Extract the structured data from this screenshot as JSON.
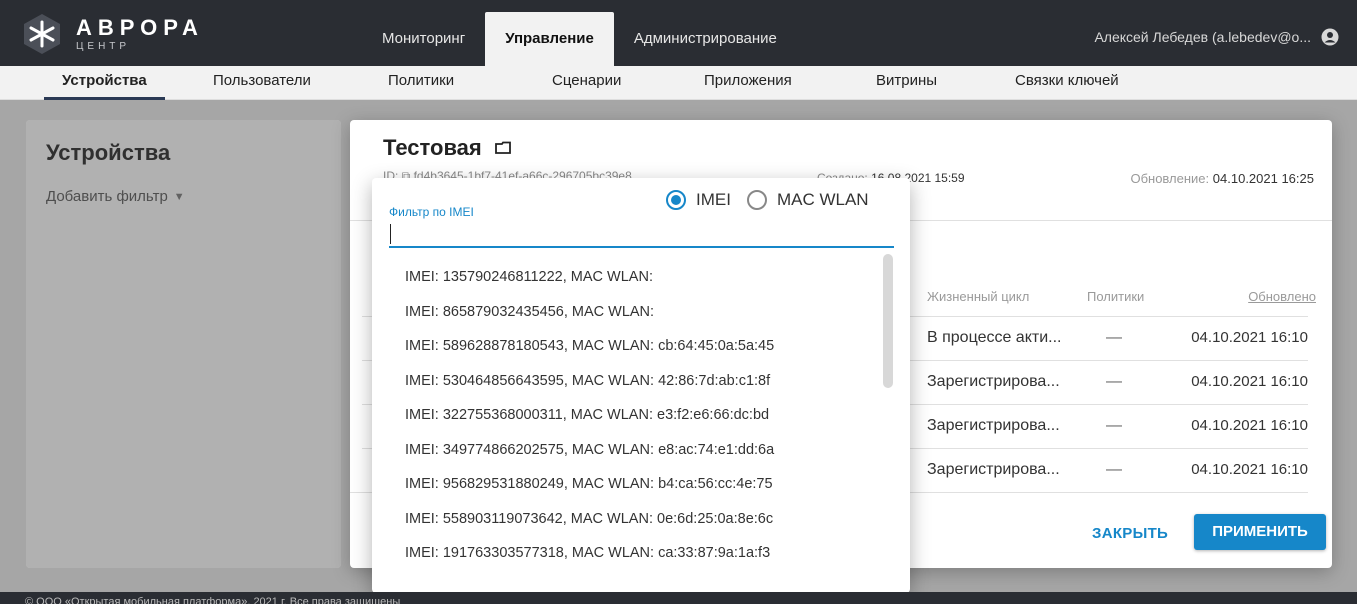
{
  "app": {
    "logo_name": "АВРОРА",
    "logo_sub": "ЦЕНТР",
    "nav": [
      "Мониторинг",
      "Управление",
      "Администрирование"
    ],
    "nav_active": "Управление",
    "user_name": "Алексей Лебедев (a.lebedev@o..."
  },
  "subnav": {
    "items": [
      "Устройства",
      "Пользователи",
      "Политики",
      "Сценарии",
      "Приложения",
      "Витрины",
      "Связки ключей"
    ],
    "active": "Устройства"
  },
  "left_panel": {
    "title": "Устройства",
    "add_filter": "Добавить фильтр"
  },
  "modal": {
    "title": "Тестовая",
    "id_label": "ID:",
    "id_value": "fd4b3645-1bf7-41ef-a66c-296705bc39e8",
    "created_label": "Создано:",
    "created_value": "16.08.2021 15:59",
    "updated_label": "Обновление:",
    "updated_value": "04.10.2021 16:25",
    "columns": {
      "lifecycle": "Жизненный цикл",
      "policies": "Политики",
      "updated": "Обновлено"
    },
    "rows": [
      {
        "lifecycle": "В процессе акти...",
        "policies": "—",
        "updated": "04.10.2021 16:10"
      },
      {
        "lifecycle": "Зарегистрирова...",
        "policies": "—",
        "updated": "04.10.2021 16:10"
      },
      {
        "lifecycle": "Зарегистрирова...",
        "policies": "—",
        "updated": "04.10.2021 16:10"
      },
      {
        "lifecycle": "Зарегистрирова...",
        "policies": "—",
        "updated": "04.10.2021 16:10"
      }
    ],
    "close_label": "ЗАКРЫТЬ",
    "apply_label": "ПРИМЕНИТЬ"
  },
  "filter_popover": {
    "label": "Фильтр по IMEI",
    "input_value": "",
    "radio_options": [
      "IMEI",
      "MAC WLAN"
    ],
    "radio_selected": "IMEI",
    "options": [
      "IMEI: 135790246811222, MAC WLAN:",
      "IMEI: 865879032435456, MAC WLAN:",
      "IMEI: 589628878180543, MAC WLAN: cb:64:45:0a:5a:45",
      "IMEI: 530464856643595, MAC WLAN: 42:86:7d:ab:c1:8f",
      "IMEI: 322755368000311, MAC WLAN: e3:f2:e6:66:dc:bd",
      "IMEI: 349774866202575, MAC WLAN: e8:ac:74:e1:dd:6a",
      "IMEI: 956829531880249, MAC WLAN: b4:ca:56:cc:4e:75",
      "IMEI: 558903119073642, MAC WLAN: 0e:6d:25:0a:8e:6c",
      "IMEI: 191763303577318, MAC WLAN: ca:33:87:9a:1a:f3"
    ]
  },
  "footer": {
    "text": "© ООО «Открытая мобильная платформа», 2021 г. Все права защищены"
  },
  "colors": {
    "accent": "#1687c9",
    "header_bg": "#2a2d33"
  }
}
